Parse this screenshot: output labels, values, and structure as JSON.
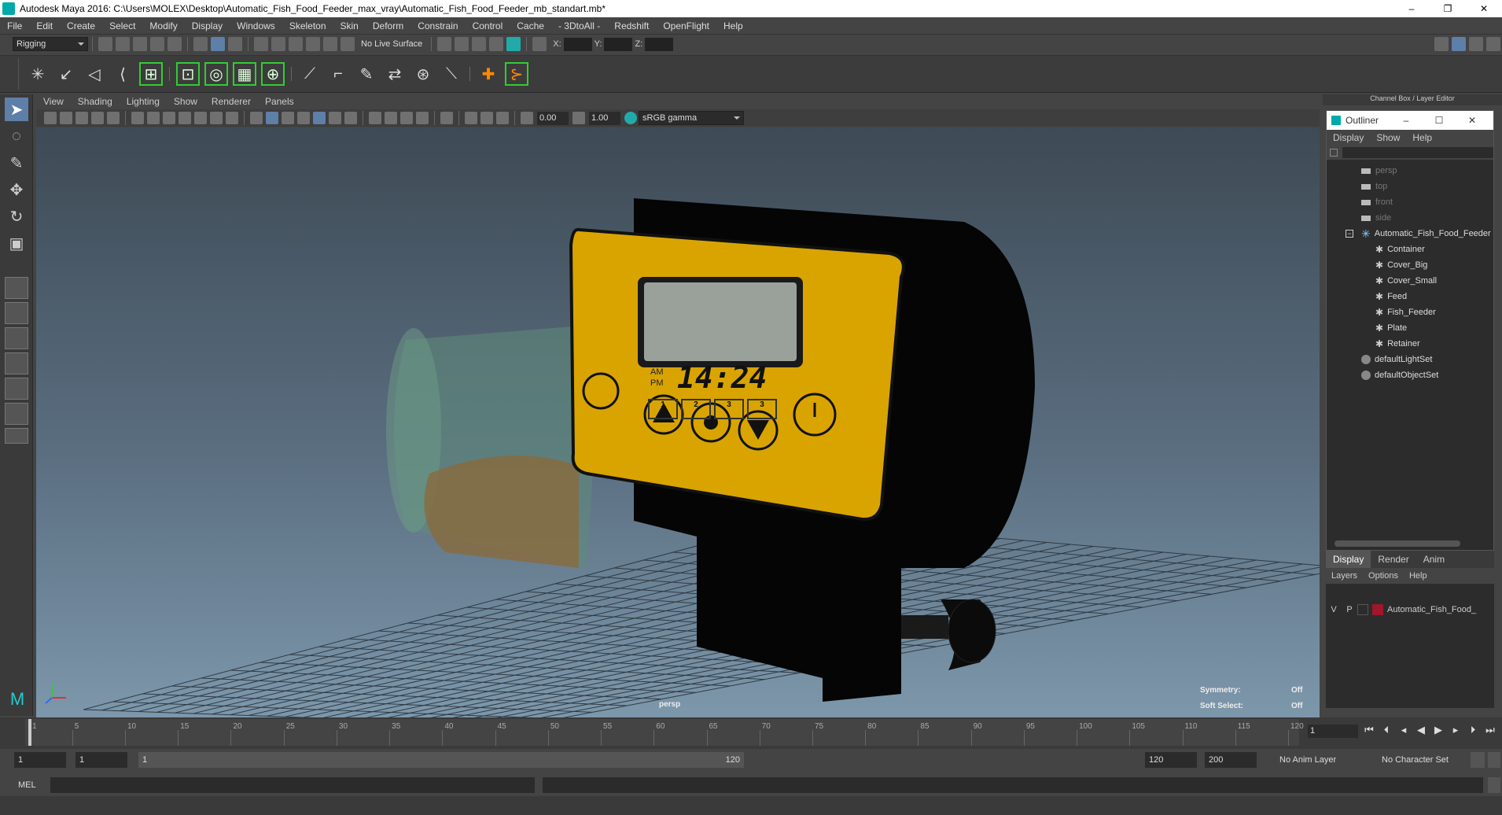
{
  "window": {
    "title": "Autodesk Maya 2016: C:\\Users\\MOLEX\\Desktop\\Automatic_Fish_Food_Feeder_max_vray\\Automatic_Fish_Food_Feeder_mb_standart.mb*",
    "minimize": "–",
    "restore": "❐",
    "close": "✕"
  },
  "menubar": [
    "File",
    "Edit",
    "Create",
    "Select",
    "Modify",
    "Display",
    "Windows",
    "Skeleton",
    "Skin",
    "Deform",
    "Constrain",
    "Control",
    "Cache",
    "- 3DtoAll -",
    "Redshift",
    "OpenFlight",
    "Help"
  ],
  "status": {
    "mode": "Rigging",
    "live_surface": "No Live Surface",
    "x_label": "X:",
    "y_label": "Y:",
    "z_label": "Z:"
  },
  "panel_menu": [
    "View",
    "Shading",
    "Lighting",
    "Show",
    "Renderer",
    "Panels"
  ],
  "panel_tools": {
    "exposure": "0.00",
    "gamma": "1.00",
    "colorspace": "sRGB gamma"
  },
  "viewport": {
    "camera": "persp",
    "symmetry_label": "Symmetry:",
    "symmetry_value": "Off",
    "softselect_label": "Soft Select:",
    "softselect_value": "Off",
    "lcd_ampm_am": "AM",
    "lcd_ampm_pm": "PM",
    "lcd_time": "14:24",
    "lcd_slots": [
      "1",
      "2",
      "3",
      "3"
    ]
  },
  "channelbox": {
    "title": "Channel Box / Layer Editor"
  },
  "outliner": {
    "title": "Outliner",
    "menu": [
      "Display",
      "Show",
      "Help"
    ],
    "cameras": [
      "persp",
      "top",
      "front",
      "side"
    ],
    "root": "Automatic_Fish_Food_Feeder",
    "children": [
      "Container",
      "Cover_Big",
      "Cover_Small",
      "Feed",
      "Fish_Feeder",
      "Plate",
      "Retainer"
    ],
    "sets": [
      "defaultLightSet",
      "defaultObjectSet"
    ]
  },
  "layers": {
    "tabs": [
      "Display",
      "Render",
      "Anim"
    ],
    "menu": [
      "Layers",
      "Options",
      "Help"
    ],
    "layer_v": "V",
    "layer_p": "P",
    "layer_name": "Automatic_Fish_Food_"
  },
  "timeline": {
    "ticks": [
      "1",
      "5",
      "10",
      "15",
      "20",
      "25",
      "30",
      "35",
      "40",
      "45",
      "50",
      "55",
      "60",
      "65",
      "70",
      "75",
      "80",
      "85",
      "90",
      "95",
      "100",
      "105",
      "110",
      "115",
      "120"
    ],
    "current": "1"
  },
  "range": {
    "start": "1",
    "start2": "1",
    "slider_start": "1",
    "slider_end": "120",
    "end": "120",
    "end2": "200",
    "anim_layer": "No Anim Layer",
    "char_set": "No Character Set"
  },
  "cmd": {
    "label": "MEL"
  },
  "colors": {
    "accent": "#5d7fa8",
    "layer": "#a0162a",
    "yellow": "#d9a400"
  }
}
